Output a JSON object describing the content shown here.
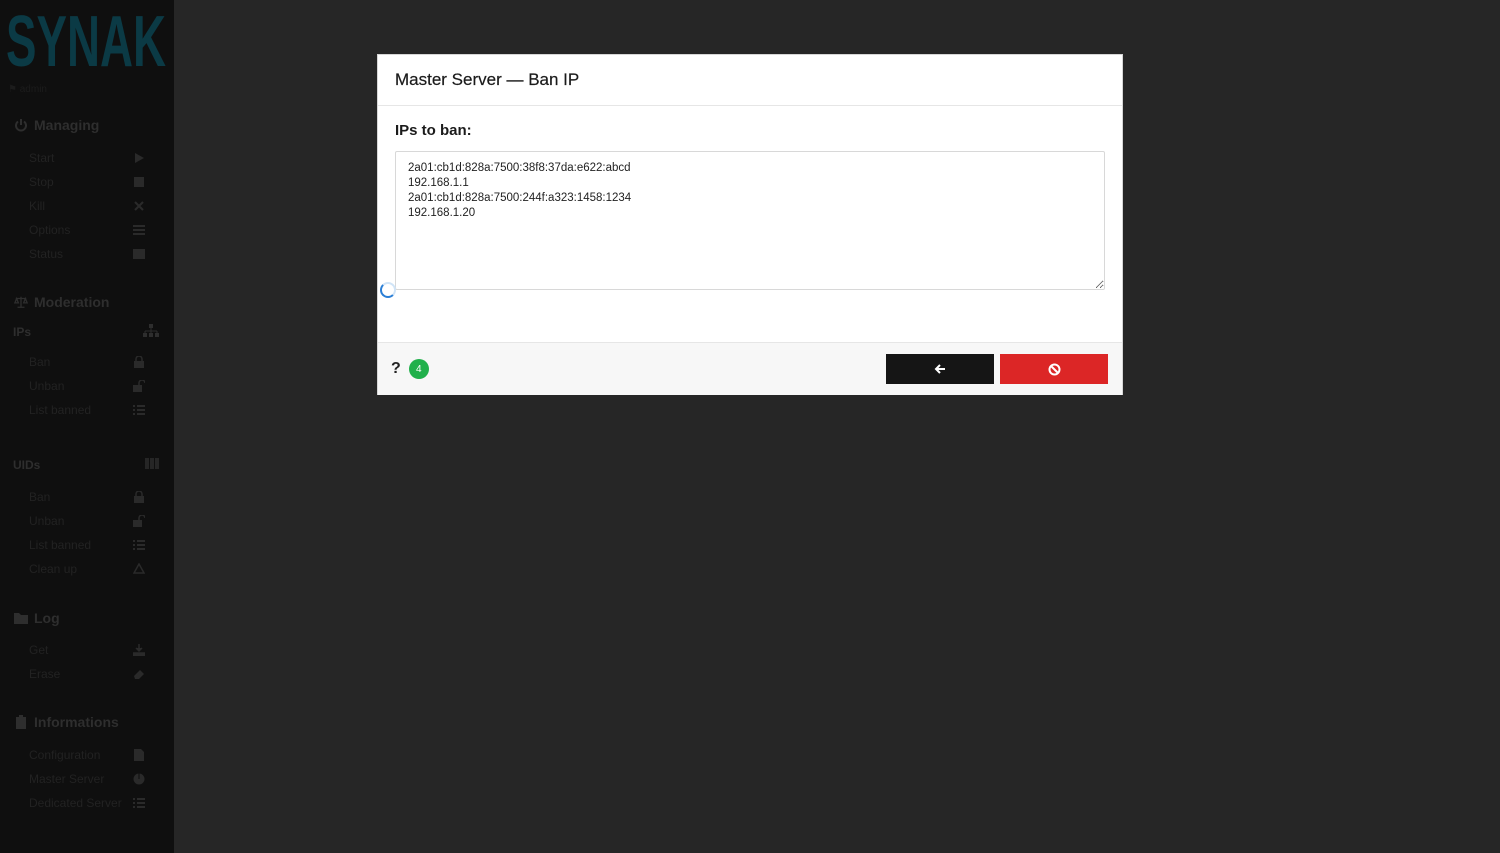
{
  "brand": {
    "logo_text": "SYNAK",
    "user_label": "admin"
  },
  "sidebar": {
    "managing": {
      "title": "Managing",
      "items": [
        {
          "label": "Start",
          "icon": "play-icon"
        },
        {
          "label": "Stop",
          "icon": "stop-icon"
        },
        {
          "label": "Kill",
          "icon": "close-icon"
        },
        {
          "label": "Options",
          "icon": "list-icon"
        },
        {
          "label": "Status",
          "icon": "table-icon"
        }
      ]
    },
    "moderation": {
      "title": "Moderation",
      "ips": {
        "title": "IPs",
        "items": [
          {
            "label": "Ban",
            "icon": "lock-icon"
          },
          {
            "label": "Unban",
            "icon": "unlock-icon"
          },
          {
            "label": "List banned",
            "icon": "list-icon"
          }
        ]
      },
      "uids": {
        "title": "UIDs",
        "items": [
          {
            "label": "Ban",
            "icon": "lock-icon"
          },
          {
            "label": "Unban",
            "icon": "unlock-icon"
          },
          {
            "label": "List banned",
            "icon": "list-icon"
          },
          {
            "label": "Clean up",
            "icon": "recycle-icon"
          }
        ]
      }
    },
    "log": {
      "title": "Log",
      "items": [
        {
          "label": "Get",
          "icon": "download-icon"
        },
        {
          "label": "Erase",
          "icon": "eraser-icon"
        }
      ]
    },
    "informations": {
      "title": "Informations",
      "items": [
        {
          "label": "Configuration",
          "icon": "file-icon"
        },
        {
          "label": "Master Server",
          "icon": "pie-chart-icon"
        },
        {
          "label": "Dedicated Server",
          "icon": "list-icon"
        }
      ]
    }
  },
  "modal": {
    "title": "Master Server — Ban IP",
    "field_label": "IPs to ban:",
    "ips_value": "2a01:cb1d:828a:7500:38f8:37da:e622:abcd\n192.168.1.1\n2a01:cb1d:828a:7500:244f:a323:1458:1234\n192.168.1.20",
    "help_label": "?",
    "ip_count": "4"
  },
  "colors": {
    "ban_button": "#dc2626",
    "back_button": "#151515",
    "count_badge": "#21b04b",
    "background": "#262626",
    "sidebar": "#0f0f0f"
  }
}
